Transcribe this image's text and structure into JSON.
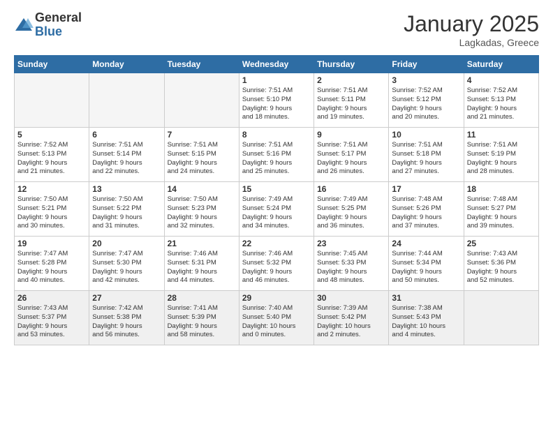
{
  "logo": {
    "general": "General",
    "blue": "Blue"
  },
  "title": "January 2025",
  "subtitle": "Lagkadas, Greece",
  "days_of_week": [
    "Sunday",
    "Monday",
    "Tuesday",
    "Wednesday",
    "Thursday",
    "Friday",
    "Saturday"
  ],
  "weeks": [
    [
      {
        "day": "",
        "info": ""
      },
      {
        "day": "",
        "info": ""
      },
      {
        "day": "",
        "info": ""
      },
      {
        "day": "1",
        "info": "Sunrise: 7:51 AM\nSunset: 5:10 PM\nDaylight: 9 hours\nand 18 minutes."
      },
      {
        "day": "2",
        "info": "Sunrise: 7:51 AM\nSunset: 5:11 PM\nDaylight: 9 hours\nand 19 minutes."
      },
      {
        "day": "3",
        "info": "Sunrise: 7:52 AM\nSunset: 5:12 PM\nDaylight: 9 hours\nand 20 minutes."
      },
      {
        "day": "4",
        "info": "Sunrise: 7:52 AM\nSunset: 5:13 PM\nDaylight: 9 hours\nand 21 minutes."
      }
    ],
    [
      {
        "day": "5",
        "info": "Sunrise: 7:52 AM\nSunset: 5:13 PM\nDaylight: 9 hours\nand 21 minutes."
      },
      {
        "day": "6",
        "info": "Sunrise: 7:51 AM\nSunset: 5:14 PM\nDaylight: 9 hours\nand 22 minutes."
      },
      {
        "day": "7",
        "info": "Sunrise: 7:51 AM\nSunset: 5:15 PM\nDaylight: 9 hours\nand 24 minutes."
      },
      {
        "day": "8",
        "info": "Sunrise: 7:51 AM\nSunset: 5:16 PM\nDaylight: 9 hours\nand 25 minutes."
      },
      {
        "day": "9",
        "info": "Sunrise: 7:51 AM\nSunset: 5:17 PM\nDaylight: 9 hours\nand 26 minutes."
      },
      {
        "day": "10",
        "info": "Sunrise: 7:51 AM\nSunset: 5:18 PM\nDaylight: 9 hours\nand 27 minutes."
      },
      {
        "day": "11",
        "info": "Sunrise: 7:51 AM\nSunset: 5:19 PM\nDaylight: 9 hours\nand 28 minutes."
      }
    ],
    [
      {
        "day": "12",
        "info": "Sunrise: 7:50 AM\nSunset: 5:21 PM\nDaylight: 9 hours\nand 30 minutes."
      },
      {
        "day": "13",
        "info": "Sunrise: 7:50 AM\nSunset: 5:22 PM\nDaylight: 9 hours\nand 31 minutes."
      },
      {
        "day": "14",
        "info": "Sunrise: 7:50 AM\nSunset: 5:23 PM\nDaylight: 9 hours\nand 32 minutes."
      },
      {
        "day": "15",
        "info": "Sunrise: 7:49 AM\nSunset: 5:24 PM\nDaylight: 9 hours\nand 34 minutes."
      },
      {
        "day": "16",
        "info": "Sunrise: 7:49 AM\nSunset: 5:25 PM\nDaylight: 9 hours\nand 36 minutes."
      },
      {
        "day": "17",
        "info": "Sunrise: 7:48 AM\nSunset: 5:26 PM\nDaylight: 9 hours\nand 37 minutes."
      },
      {
        "day": "18",
        "info": "Sunrise: 7:48 AM\nSunset: 5:27 PM\nDaylight: 9 hours\nand 39 minutes."
      }
    ],
    [
      {
        "day": "19",
        "info": "Sunrise: 7:47 AM\nSunset: 5:28 PM\nDaylight: 9 hours\nand 40 minutes."
      },
      {
        "day": "20",
        "info": "Sunrise: 7:47 AM\nSunset: 5:30 PM\nDaylight: 9 hours\nand 42 minutes."
      },
      {
        "day": "21",
        "info": "Sunrise: 7:46 AM\nSunset: 5:31 PM\nDaylight: 9 hours\nand 44 minutes."
      },
      {
        "day": "22",
        "info": "Sunrise: 7:46 AM\nSunset: 5:32 PM\nDaylight: 9 hours\nand 46 minutes."
      },
      {
        "day": "23",
        "info": "Sunrise: 7:45 AM\nSunset: 5:33 PM\nDaylight: 9 hours\nand 48 minutes."
      },
      {
        "day": "24",
        "info": "Sunrise: 7:44 AM\nSunset: 5:34 PM\nDaylight: 9 hours\nand 50 minutes."
      },
      {
        "day": "25",
        "info": "Sunrise: 7:43 AM\nSunset: 5:36 PM\nDaylight: 9 hours\nand 52 minutes."
      }
    ],
    [
      {
        "day": "26",
        "info": "Sunrise: 7:43 AM\nSunset: 5:37 PM\nDaylight: 9 hours\nand 53 minutes."
      },
      {
        "day": "27",
        "info": "Sunrise: 7:42 AM\nSunset: 5:38 PM\nDaylight: 9 hours\nand 56 minutes."
      },
      {
        "day": "28",
        "info": "Sunrise: 7:41 AM\nSunset: 5:39 PM\nDaylight: 9 hours\nand 58 minutes."
      },
      {
        "day": "29",
        "info": "Sunrise: 7:40 AM\nSunset: 5:40 PM\nDaylight: 10 hours\nand 0 minutes."
      },
      {
        "day": "30",
        "info": "Sunrise: 7:39 AM\nSunset: 5:42 PM\nDaylight: 10 hours\nand 2 minutes."
      },
      {
        "day": "31",
        "info": "Sunrise: 7:38 AM\nSunset: 5:43 PM\nDaylight: 10 hours\nand 4 minutes."
      },
      {
        "day": "",
        "info": ""
      }
    ]
  ]
}
